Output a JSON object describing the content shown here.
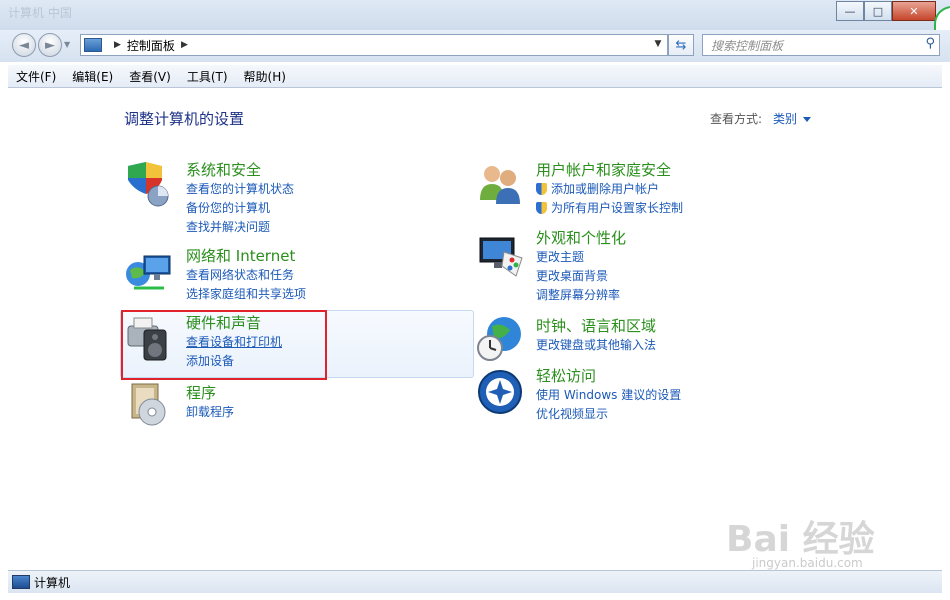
{
  "window": {
    "bg_title": "计算机 中国",
    "buttons": [
      "—",
      "□",
      "✕"
    ]
  },
  "nav": {
    "back_icon": "back-arrow-icon",
    "forward_icon": "forward-arrow-icon",
    "address_path": "控制面板",
    "search_placeholder": "搜索控制面板"
  },
  "menu": [
    "文件(F)",
    "编辑(E)",
    "查看(V)",
    "工具(T)",
    "帮助(H)"
  ],
  "page": {
    "title": "调整计算机的设置",
    "view_by_label": "查看方式:",
    "view_by_value": "类别"
  },
  "categories_left": [
    {
      "title": "系统和安全",
      "icon": "shield-pie-icon",
      "links": [
        "查看您的计算机状态",
        "备份您的计算机",
        "查找并解决问题"
      ]
    },
    {
      "title": "网络和 Internet",
      "icon": "network-globe-icon",
      "links": [
        "查看网络状态和任务",
        "选择家庭组和共享选项"
      ]
    },
    {
      "title": "硬件和声音",
      "icon": "printer-speaker-icon",
      "links": [
        "查看设备和打印机",
        "添加设备"
      ]
    },
    {
      "title": "程序",
      "icon": "program-disc-icon",
      "links": [
        "卸载程序"
      ]
    }
  ],
  "categories_right": [
    {
      "title": "用户帐户和家庭安全",
      "icon": "users-icon",
      "links": [
        "添加或删除用户帐户",
        "为所有用户设置家长控制"
      ]
    },
    {
      "title": "外观和个性化",
      "icon": "monitor-palette-icon",
      "links": [
        "更改主题",
        "更改桌面背景",
        "调整屏幕分辨率"
      ]
    },
    {
      "title": "时钟、语言和区域",
      "icon": "clock-globe-icon",
      "links": [
        "更改键盘或其他输入法"
      ]
    },
    {
      "title": "轻松访问",
      "icon": "ease-of-access-icon",
      "links": [
        "使用 Windows 建议的设置",
        "优化视频显示"
      ]
    }
  ],
  "status_bar": {
    "text": "计算机"
  },
  "watermark": {
    "brand": "Bai 经验",
    "url": "jingyan.baidu.com"
  }
}
